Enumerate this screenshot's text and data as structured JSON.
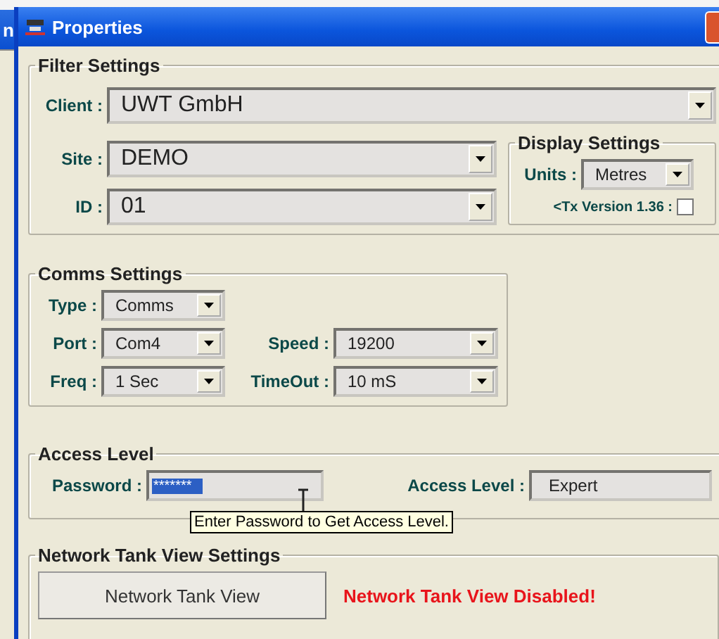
{
  "background_window": {
    "title_fragment": "n"
  },
  "window": {
    "title": "Properties"
  },
  "filter_settings": {
    "title": "Filter Settings",
    "client": {
      "label": "Client :",
      "value": "UWT GmbH"
    },
    "site": {
      "label": "Site :",
      "value": "DEMO"
    },
    "id": {
      "label": "ID :",
      "value": "01"
    }
  },
  "display_settings": {
    "title": "Display Settings",
    "units": {
      "label": "Units :",
      "value": "Metres"
    },
    "tx_version": {
      "label": "<Tx Version 1.36 :",
      "checked": false
    }
  },
  "comms_settings": {
    "title": "Comms Settings",
    "type": {
      "label": "Type :",
      "value": "Comms"
    },
    "port": {
      "label": "Port :",
      "value": "Com4"
    },
    "speed": {
      "label": "Speed :",
      "value": "19200"
    },
    "freq": {
      "label": "Freq :",
      "value": "1 Sec"
    },
    "timeout": {
      "label": "TimeOut :",
      "value": "10 mS"
    }
  },
  "access_level": {
    "title": "Access Level",
    "password": {
      "label": "Password :",
      "value": "*******",
      "text_selected": true
    },
    "level": {
      "label": "Access Level :",
      "value": "Expert"
    },
    "tooltip": "Enter Password to Get Access Level."
  },
  "network": {
    "title": "Network Tank View Settings",
    "button": "Network Tank View",
    "status": "Network Tank View Disabled!"
  }
}
